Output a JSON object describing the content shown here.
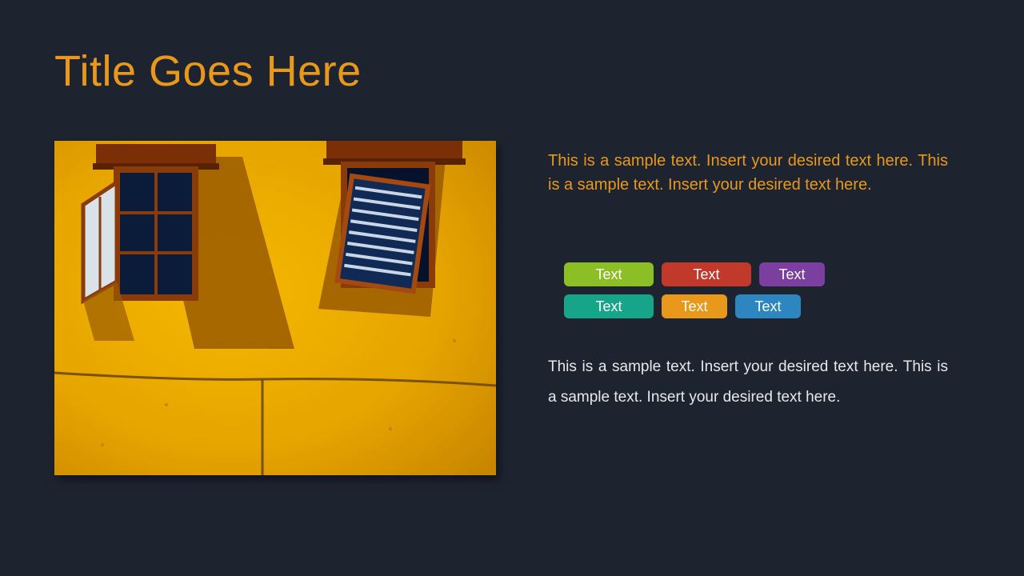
{
  "title": "Title Goes Here",
  "para_top": "This is a sample text. Insert your desired text here. This is a sample text. Insert your desired text here.",
  "para_bottom": "This is a sample text. Insert your desired text here. This is a sample text. Insert your desired text here.",
  "tags": {
    "row1": [
      {
        "label": "Text",
        "color": "#8cbf26"
      },
      {
        "label": "Text",
        "color": "#c0392b"
      },
      {
        "label": "Text",
        "color": "#7b3fa0"
      }
    ],
    "row2": [
      {
        "label": "Text",
        "color": "#17a589"
      },
      {
        "label": "Text",
        "color": "#e8991c"
      },
      {
        "label": "Text",
        "color": "#2e86c1"
      }
    ]
  },
  "image": {
    "alt": "Yellow stucco wall with two open wooden-frame windows casting long shadows, a cable running along the wall",
    "wall": "#e6a400",
    "shadow": "#9a5b00",
    "frame": "#8a3b0a",
    "inner": "#0b1b3a"
  }
}
